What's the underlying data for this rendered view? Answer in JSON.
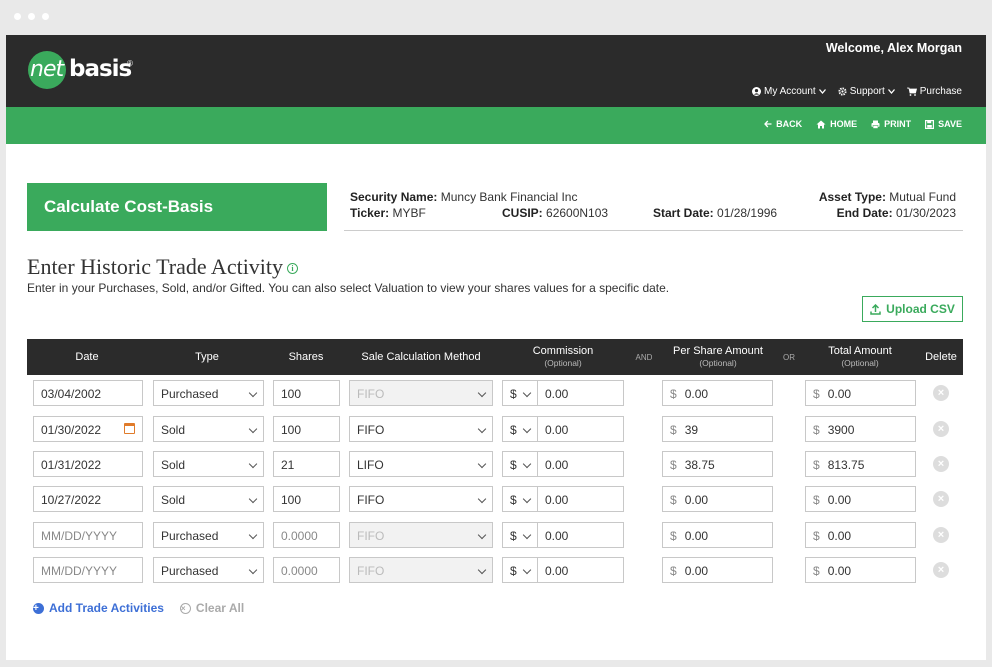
{
  "header": {
    "logo_net": "net",
    "logo_basis": "basis",
    "logo_reg": "®",
    "welcome": "Welcome, Alex Morgan",
    "nav": [
      {
        "label": "My Account",
        "icon": "user-icon"
      },
      {
        "label": "Support",
        "icon": "gear-icon"
      },
      {
        "label": "Purchase",
        "icon": "cart-icon"
      }
    ]
  },
  "actions": [
    {
      "label": "BACK",
      "icon": "arrow-left-icon"
    },
    {
      "label": "HOME",
      "icon": "home-icon"
    },
    {
      "label": "PRINT",
      "icon": "print-icon"
    },
    {
      "label": "SAVE",
      "icon": "save-icon"
    }
  ],
  "calc_title": "Calculate Cost-Basis",
  "security": {
    "name_label": "Security Name:",
    "name": "Muncy Bank Financial Inc",
    "ticker_label": "Ticker:",
    "ticker": "MYBF",
    "cusip_label": "CUSIP:",
    "cusip": "62600N103",
    "start_label": "Start Date:",
    "start": "01/28/1996",
    "asset_label": "Asset Type:",
    "asset": "Mutual Fund",
    "end_label": "End Date:",
    "end": "01/30/2023"
  },
  "section": {
    "title": "Enter Historic Trade Activity",
    "info_icon": "i",
    "description": "Enter in your Purchases, Sold, and/or Gifted. You can also select Valuation to view your shares values for a specific date.",
    "upload_label": "Upload CSV"
  },
  "table": {
    "headers": {
      "date": "Date",
      "type": "Type",
      "shares": "Shares",
      "method": "Sale Calculation Method",
      "commission": "Commission",
      "commission_sub": "(Optional)",
      "and": "AND",
      "per_share": "Per Share Amount",
      "per_share_sub": "(Optional)",
      "or": "OR",
      "total": "Total Amount",
      "total_sub": "(Optional)",
      "delete": "Delete"
    },
    "currency": "$",
    "rows": [
      {
        "date": "03/04/2002",
        "type": "Purchased",
        "shares": "100",
        "method": "FIFO",
        "commission": "0.00",
        "per_share": "0.00",
        "total": "0.00"
      },
      {
        "date": "01/30/2022",
        "type": "Sold",
        "shares": "100",
        "method": "FIFO",
        "commission": "0.00",
        "per_share": "39",
        "total": "3900"
      },
      {
        "date": "01/31/2022",
        "type": "Sold",
        "shares": "21",
        "method": "LIFO",
        "commission": "0.00",
        "per_share": "38.75",
        "total": "813.75"
      },
      {
        "date": "10/27/2022",
        "type": "Sold",
        "shares": "100",
        "method": "FIFO",
        "commission": "0.00",
        "per_share": "0.00",
        "total": "0.00"
      },
      {
        "date": "MM/DD/YYYY",
        "type": "Purchased",
        "shares": "0.0000",
        "method": "FIFO",
        "commission": "0.00",
        "per_share": "0.00",
        "total": "0.00"
      },
      {
        "date": "MM/DD/YYYY",
        "type": "Purchased",
        "shares": "0.0000",
        "method": "FIFO",
        "commission": "0.00",
        "per_share": "0.00",
        "total": "0.00"
      }
    ]
  },
  "footer_actions": {
    "add_label": "Add Trade Activities",
    "clear_label": "Clear All"
  },
  "colors": {
    "brand_green": "#3aaa5c",
    "dark": "#2b2b2b",
    "link_blue": "#3d6fd6"
  }
}
